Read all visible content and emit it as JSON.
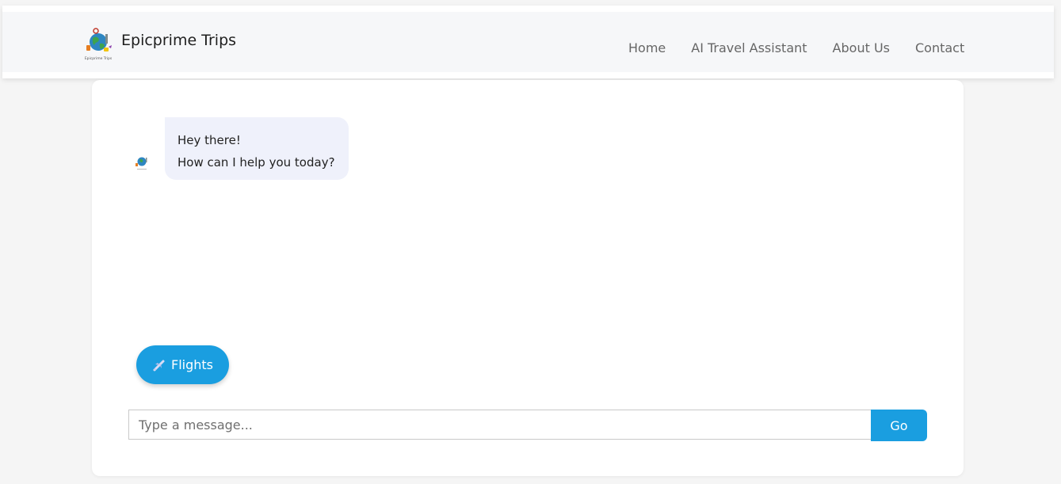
{
  "header": {
    "brand": "Epicprime Trips",
    "logo_icon": "globe-travel-logo-icon",
    "logo_caption": "Epicprime Trips",
    "nav": [
      {
        "label": "Home"
      },
      {
        "label": "AI Travel Assistant"
      },
      {
        "label": "About Us"
      },
      {
        "label": "Contact"
      }
    ]
  },
  "chat": {
    "bot_avatar_icon": "globe-travel-logo-icon",
    "messages": [
      {
        "line1": "Hey there!",
        "line2": "How can I help you today?"
      }
    ],
    "quick_reply": {
      "label": "Flights",
      "icon": "airplane-icon"
    },
    "input": {
      "placeholder": "Type a message...",
      "value": ""
    },
    "send_label": "Go"
  },
  "colors": {
    "accent": "#1a9ee0",
    "bubble_bg": "#eff1fb",
    "page_bg": "#f5f5f5",
    "header_bg": "#f6f7f9"
  }
}
